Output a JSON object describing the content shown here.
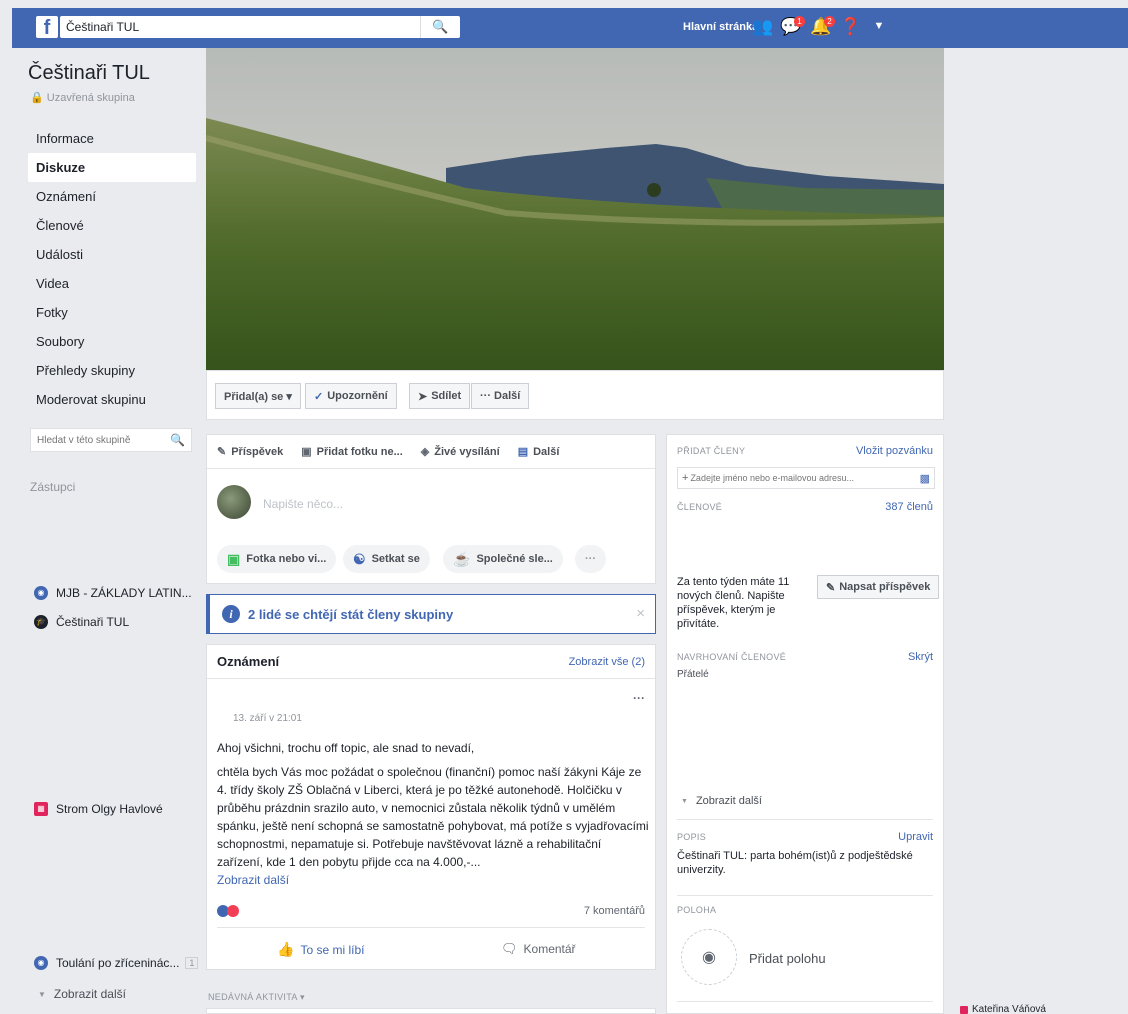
{
  "topbar": {
    "logo": "f",
    "search_value": "Češtinaři TUL",
    "home_label": "Hlavní stránka",
    "badges": {
      "messages": "1",
      "notifications": "2"
    },
    "icons": [
      "friends-icon",
      "messenger-icon",
      "notifications-icon",
      "help-icon",
      "caret-icon"
    ]
  },
  "sidebar": {
    "group_name": "Češtinaři TUL",
    "group_type": "Uzavřená skupina",
    "nav": [
      "Informace",
      "Diskuze",
      "Oznámení",
      "Členové",
      "Události",
      "Videa",
      "Fotky",
      "Soubory",
      "Přehledy skupiny",
      "Moderovat skupinu"
    ],
    "active_index": 1,
    "search_placeholder": "Hledat v této skupině",
    "shortcuts_title": "Zástupci",
    "shortcuts": [
      {
        "label": "MJB - ZÁKLADY LATIN..."
      },
      {
        "label": "Češtinaři TUL"
      },
      {
        "label": "Strom Olgy Havlové"
      },
      {
        "label": "Toulání po zříceninác...",
        "count": "1"
      }
    ],
    "show_more": "Zobrazit další"
  },
  "actions": {
    "join": "Přidal(a) se ▾",
    "notify": "Upozornění",
    "share": "Sdílet",
    "more": "··· Další"
  },
  "composer": {
    "tabs": [
      "Příspěvek",
      "Přidat fotku ne...",
      "Živé vysílání",
      "Další"
    ],
    "placeholder": "Napište něco...",
    "pills": [
      "Fotka nebo vi...",
      "Setkat se",
      "Společné sle...",
      "···"
    ]
  },
  "notice": {
    "text": "2 lidé se chtějí stát členy skupiny",
    "close": "×"
  },
  "announcements": {
    "title": "Oznámení",
    "see_all": "Zobrazit vše (2)",
    "menu": "···",
    "date": "13. září v 21:01",
    "greeting": "Ahoj všichni, trochu off topic, ale snad to nevadí,",
    "body": "chtěla bych Vás moc požádat o společnou (finanční) pomoc naší žákyni Káje ze 4. třídy školy ZŠ Oblačná v Liberci, která je po těžké autonehodě. Holčičku v průběhu prázdnin srazilo auto, v nemocnici zůstala několik týdnů v umělém spánku, ještě není schopná se samostatně pohybovat, má potíže s vyjadřovacími schopnostmi, nepamatuje si. Potřebuje navštěvovat lázně a rehabilitační zařízení, kde 1 den pobytu přijde cca na 4.000,-...",
    "more": "Zobrazit další",
    "comments": "7 komentářů",
    "like": "To se mi líbí",
    "comment": "Komentář"
  },
  "recent_activity": "NEDÁVNÁ AKTIVITA ▾",
  "right": {
    "add_members": "PŘIDAT ČLENY",
    "invite": "Vložit pozvánku",
    "add_placeholder": "Zadejte jméno nebo e-mailovou adresu...",
    "members_label": "ČLENOVÉ",
    "members_count": "387 členů",
    "new_members_text": "Za tento týden máte 11 nových členů. Napište příspěvek, kterým je přivítáte.",
    "write_post": "Napsat příspěvek",
    "suggested_label": "NAVRHOVANÍ ČLENOVÉ",
    "hide": "Skrýt",
    "friends": "Přátelé",
    "show_more": "Zobrazit další",
    "description_label": "POPIS",
    "edit": "Upravit",
    "description": "Češtinaři TUL: parta bohém(ist)ů z podještědské univerzity.",
    "location_label": "POLOHA",
    "add_location": "Přidat polohu"
  },
  "chat": {
    "name": "Kateřina Váňová"
  }
}
